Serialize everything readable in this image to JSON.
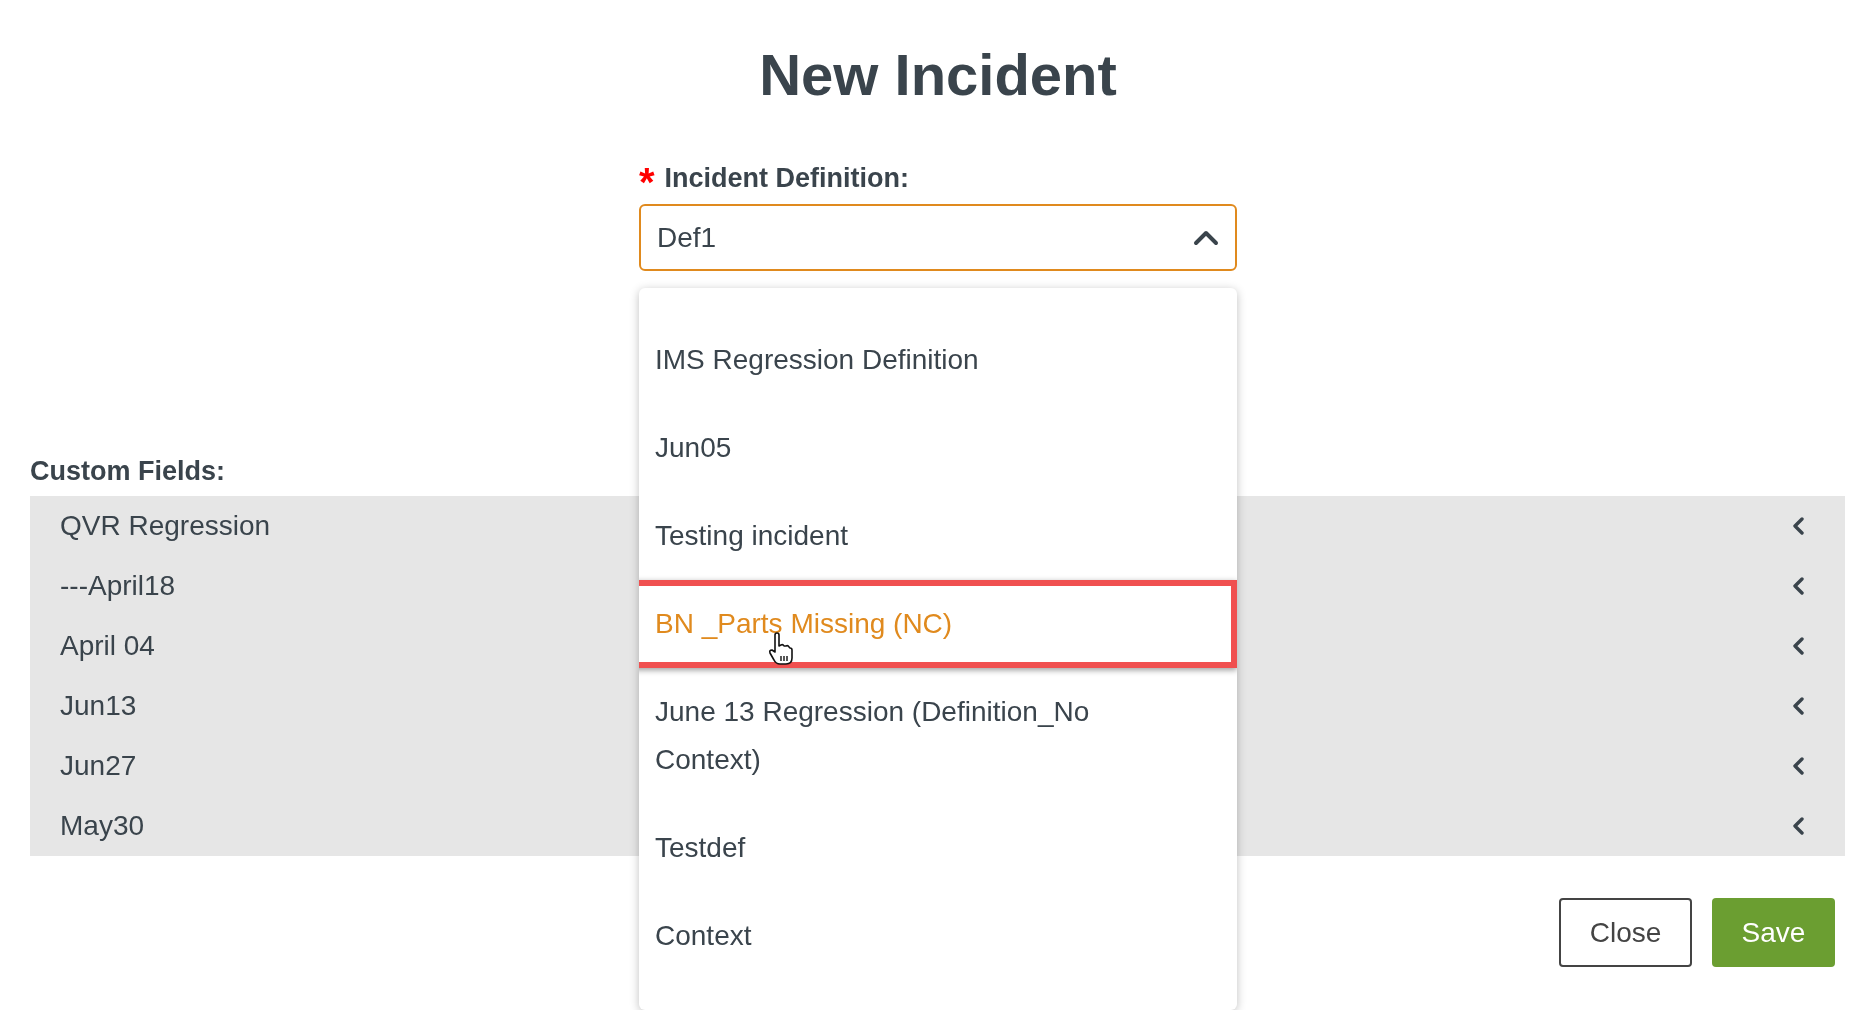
{
  "title": "New Incident",
  "definition_field": {
    "label": "Incident Definition:",
    "required_mark": "*",
    "value": "Def1",
    "expanded": true
  },
  "dropdown_options": [
    {
      "label": "IMS Regression Definition",
      "selected": false
    },
    {
      "label": "Jun05",
      "selected": false
    },
    {
      "label": "Testing incident",
      "selected": false
    },
    {
      "label": "BN _Parts Missing (NC)",
      "selected": true
    },
    {
      "label": "June 13 Regression (Definition_No Context)",
      "selected": false
    },
    {
      "label": "Testdef",
      "selected": false
    },
    {
      "label": "Context",
      "selected": false
    }
  ],
  "custom_fields": {
    "label": "Custom Fields:",
    "rows": [
      {
        "label": "QVR Regression",
        "expanded": false
      },
      {
        "label": "---April18",
        "expanded": false
      },
      {
        "label": "April 04",
        "expanded": false
      },
      {
        "label": "Jun13",
        "expanded": false
      },
      {
        "label": "Jun27",
        "expanded": false
      },
      {
        "label": "May30",
        "expanded": false
      }
    ]
  },
  "buttons": [
    {
      "label": "Close",
      "kind": "secondary"
    },
    {
      "label": "Save",
      "kind": "primary"
    }
  ]
}
